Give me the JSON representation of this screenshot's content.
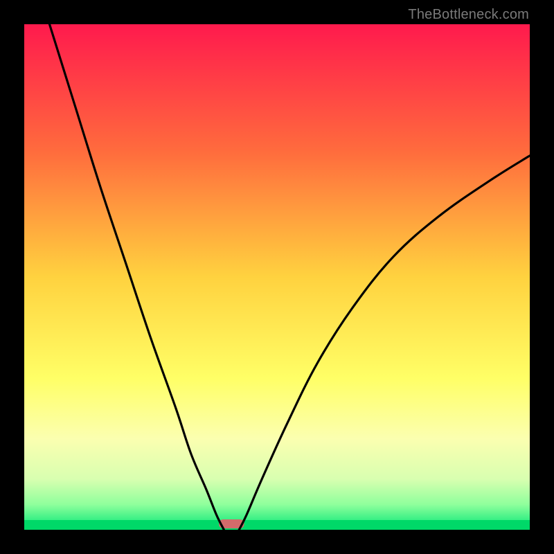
{
  "watermark": "TheBottleneck.com",
  "chart_data": {
    "type": "line",
    "title": "",
    "xlabel": "",
    "ylabel": "",
    "xlim": [
      0,
      100
    ],
    "ylim": [
      0,
      100
    ],
    "x_min_curve": 40,
    "gradient_stops": [
      {
        "offset": 0,
        "color": "#ff1a4d"
      },
      {
        "offset": 25,
        "color": "#ff6b3d"
      },
      {
        "offset": 50,
        "color": "#ffd23f"
      },
      {
        "offset": 70,
        "color": "#ffff66"
      },
      {
        "offset": 82,
        "color": "#fbffb0"
      },
      {
        "offset": 90,
        "color": "#d8ffb0"
      },
      {
        "offset": 95,
        "color": "#8fff9c"
      },
      {
        "offset": 100,
        "color": "#00e676"
      }
    ],
    "series": [
      {
        "name": "left-curve",
        "x": [
          5,
          10,
          15,
          20,
          25,
          30,
          33,
          36,
          38,
          39.5
        ],
        "y": [
          100,
          84,
          68,
          53,
          38,
          24,
          15,
          8,
          3,
          0
        ]
      },
      {
        "name": "right-curve",
        "x": [
          42.5,
          44,
          47,
          52,
          58,
          65,
          73,
          82,
          92,
          100
        ],
        "y": [
          0,
          3,
          10,
          21,
          33,
          44,
          54,
          62,
          69,
          74
        ]
      }
    ],
    "marker": {
      "x_center": 41,
      "width": 5,
      "color": "#d36b6b"
    }
  }
}
